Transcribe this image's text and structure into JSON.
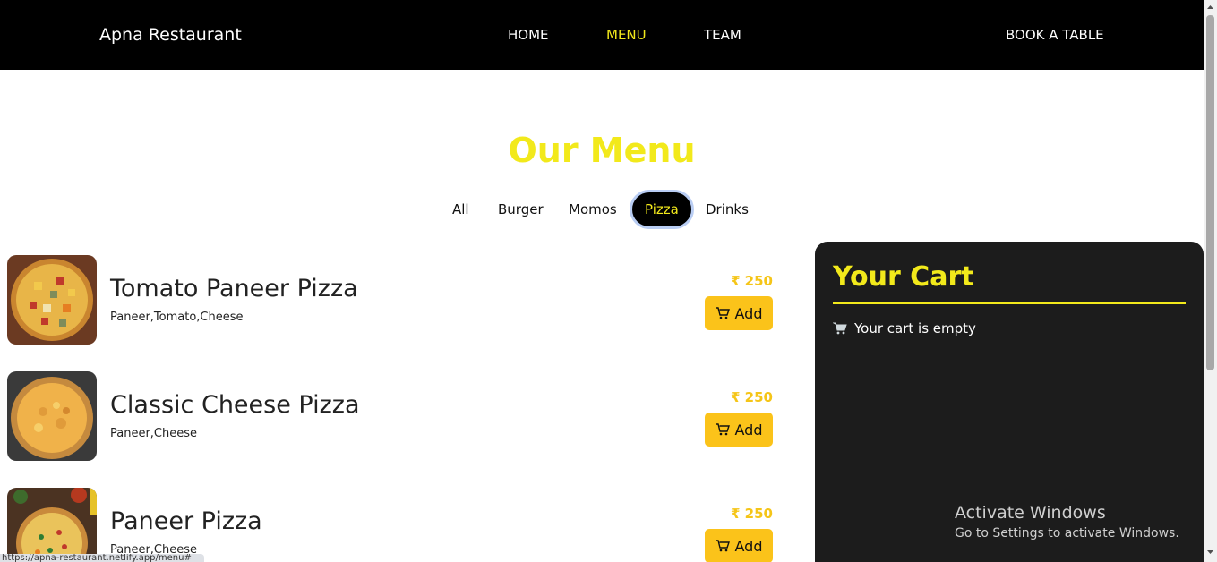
{
  "navbar": {
    "brand": "Apna Restaurant",
    "links": [
      {
        "label": "HOME"
      },
      {
        "label": "MENU"
      },
      {
        "label": "TEAM"
      }
    ],
    "active_link": "MENU",
    "book_label": "BOOK A TABLE"
  },
  "menu": {
    "title": "Our Menu",
    "filters": [
      "All",
      "Burger",
      "Momos",
      "Pizza",
      "Drinks"
    ],
    "active_filter": "Pizza",
    "items": [
      {
        "name": "Tomato Paneer Pizza",
        "desc": "Paneer,Tomato,Cheese",
        "price": "₹ 250",
        "add_label": "Add"
      },
      {
        "name": "Classic Cheese Pizza",
        "desc": "Paneer,Cheese",
        "price": "₹ 250",
        "add_label": "Add"
      },
      {
        "name": "Paneer Pizza",
        "desc": "Paneer,Cheese",
        "price": "₹ 250",
        "add_label": "Add"
      }
    ]
  },
  "cart": {
    "title": "Your Cart",
    "empty_text": "Your cart is empty"
  },
  "watermark": {
    "title": "Activate Windows",
    "subtitle": "Go to Settings to activate Windows."
  },
  "status_bar": {
    "url": "https://apna-restaurant.netlify.app/menu#"
  },
  "colors": {
    "accent": "#f2e91b",
    "button": "#fbc31a",
    "navbar_bg": "#000000",
    "cart_bg": "#1c1c1c"
  }
}
